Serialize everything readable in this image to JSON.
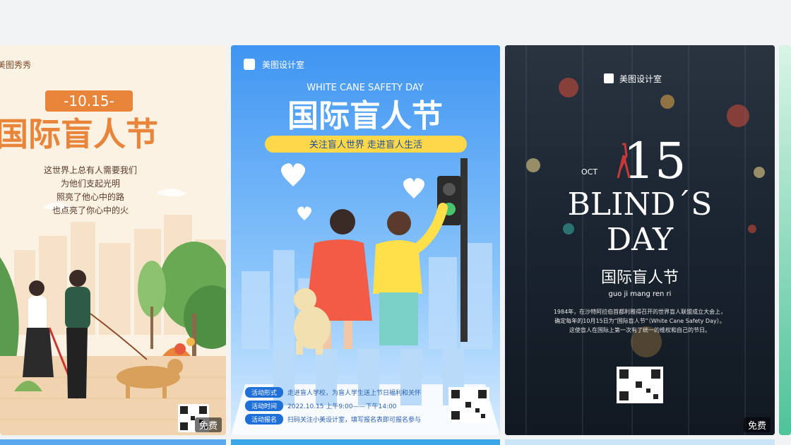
{
  "colors": {
    "page_bg": "#f2f3f5",
    "card1_bg": "#fbf2e4",
    "card1_accent": "#e8853a",
    "card2_bg": "#3a8ff0",
    "card2_banner": "#ffd84a",
    "card3_bg": "#17202b"
  },
  "cards": [
    {
      "brand": "美图秀秀",
      "date_tag": "-10.15-",
      "title": "国际盲人节",
      "poem": [
        "这世界上总有人需要我们",
        "为他们支起光明",
        "照亮了他心中的路",
        "也点亮了你心中的火"
      ],
      "badge": "免费"
    },
    {
      "brand": "美图设计室",
      "subtitle_en": "WHITE CANE SAFETY DAY",
      "title": "国际盲人节",
      "banner": "关注盲人世界  走进盲人生活",
      "info_labels": [
        "活动形式",
        "活动时间",
        "活动报名"
      ],
      "info_values": [
        "走进盲人学校，为盲人学生送上节日福利和关怀",
        "2022.10.15 上午9:00——下午14:00",
        "扫码关注小美设计室，填写报名表即可报名参与"
      ]
    },
    {
      "brand": "美图设计室",
      "month": "OCT",
      "day": "15",
      "heading_line1": "BLIND´S",
      "heading_line2": "DAY",
      "title": "国际盲人节",
      "pinyin": "guo    ji    mang   ren    ri",
      "paragraph": [
        "1984年，在沙特阿拉伯首都利雅得召开的世界盲人联盟成立大会上，",
        "确定每年的10月15日为“国际盲人节”（White Cane Safety Day）。",
        "这使盲人在国际上第一次有了统一的维权和自己的节日。"
      ],
      "badge": "免费"
    }
  ]
}
